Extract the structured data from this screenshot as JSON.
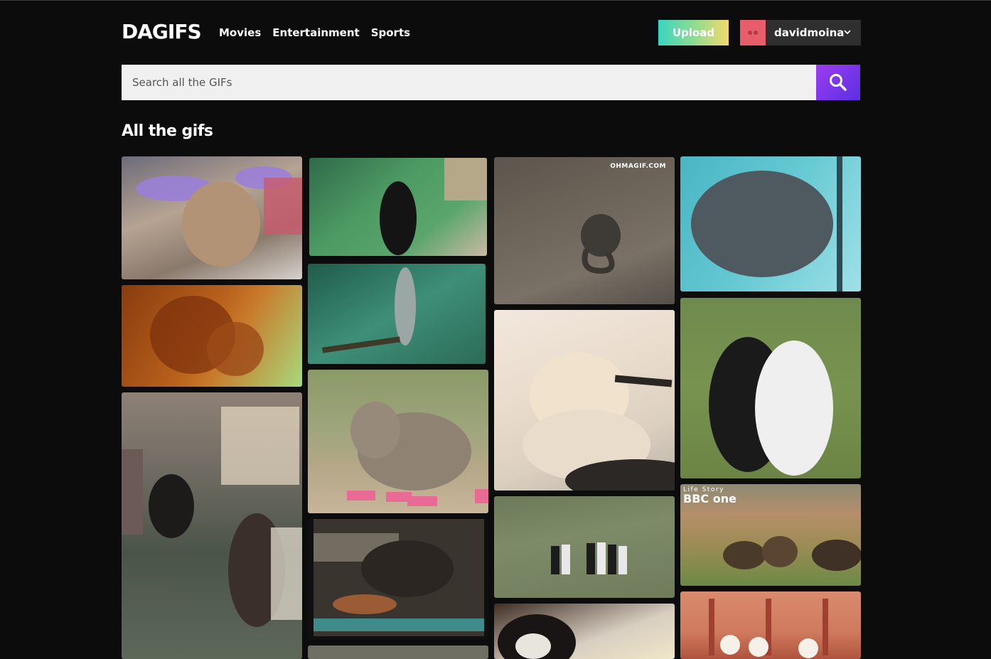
{
  "header": {
    "logo": "DAGIFS",
    "nav": [
      "Movies",
      "Entertainment",
      "Sports"
    ],
    "upload_label": "Upload",
    "username": "davidmoina"
  },
  "search": {
    "placeholder": "Search all the GIFs"
  },
  "section_title": "All the gifs",
  "colors": {
    "background": "#0c0c0d",
    "search_button": "#7b36ea",
    "avatar": "#e85d6a"
  },
  "gifs": [
    {
      "subject": "puppy with fairy wings"
    },
    {
      "subject": "orangutan mother and baby"
    },
    {
      "subject": "emu chick and dog"
    },
    {
      "subject": "seal in pool"
    },
    {
      "subject": "sea lion jumping"
    },
    {
      "subject": "baby elephant in pink sneakers"
    },
    {
      "subject": "dogs by pool"
    },
    {
      "subject": "octopus on sand",
      "watermark": "OHMAGIF.COM"
    },
    {
      "subject": "cat with makeup brush"
    },
    {
      "subject": "penguins walking"
    },
    {
      "subject": "cat close up"
    },
    {
      "subject": "manatee underwater"
    },
    {
      "subject": "two border collies"
    },
    {
      "subject": "wild dogs in savanna",
      "watermark_line1": "Life Story",
      "watermark_line2": "BBC one"
    },
    {
      "subject": "poodles on stage"
    }
  ]
}
